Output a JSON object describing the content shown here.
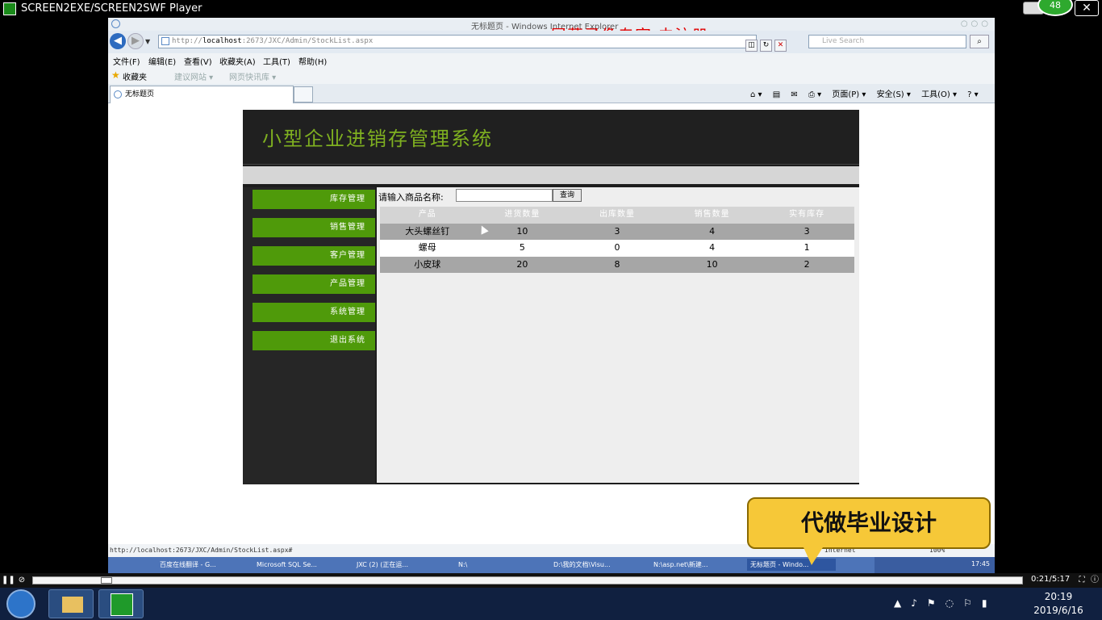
{
  "player": {
    "title": "SCREEN2EXE/SCREEN2SWF Player",
    "badge": "48",
    "time": "0:21/5:17"
  },
  "watermark": "屏幕录像专家  未注册",
  "browser": {
    "window_title": "无标题页 - Windows Internet Explorer",
    "address_prefix": "http://",
    "address_host": "localhost",
    "address_rest": ":2673/JXC/Admin/StockList.aspx",
    "search_placeholder": "Live Search",
    "menu": [
      "文件(F)",
      "编辑(E)",
      "查看(V)",
      "收藏夹(A)",
      "工具(T)",
      "帮助(H)"
    ],
    "favorites_label": "收藏夹",
    "fav_items": [
      "建议网站 ▾",
      "网页快讯库 ▾"
    ],
    "tab_title": "无标题页",
    "cmd_items": [
      "页面(P) ▾",
      "安全(S) ▾",
      "工具(O) ▾"
    ],
    "status_url": "http://localhost:2673/JXC/Admin/StockList.aspx#",
    "status_zone": "Internet",
    "status_zoom": "100%"
  },
  "app": {
    "title": "小型企业进销存管理系统",
    "sidebar": [
      "库存管理",
      "销售管理",
      "客户管理",
      "产品管理",
      "系统管理",
      "退出系统"
    ],
    "query_label": "请输入商品名称:",
    "query_button": "查询",
    "columns": [
      "产品",
      "进货数量",
      "出库数量",
      "销售数量",
      "实有库存"
    ],
    "rows": [
      [
        "大头螺丝钉",
        "10",
        "3",
        "4",
        "3"
      ],
      [
        "螺母",
        "5",
        "0",
        "4",
        "1"
      ],
      [
        "小皮球",
        "20",
        "8",
        "10",
        "2"
      ]
    ]
  },
  "taskbar_xp": [
    "百度在线翻译 - G...",
    "Microsoft SQL Se...",
    "JXC (2) (正在运...",
    "N:\\",
    "D:\\我的文档\\Visu...",
    "N:\\asp.net\\新建...",
    "无标题页 - Windo..."
  ],
  "xp_clock": "17:45",
  "bubble": "代做毕业设计",
  "clock": {
    "time": "20:19",
    "date": "2019/6/16"
  }
}
